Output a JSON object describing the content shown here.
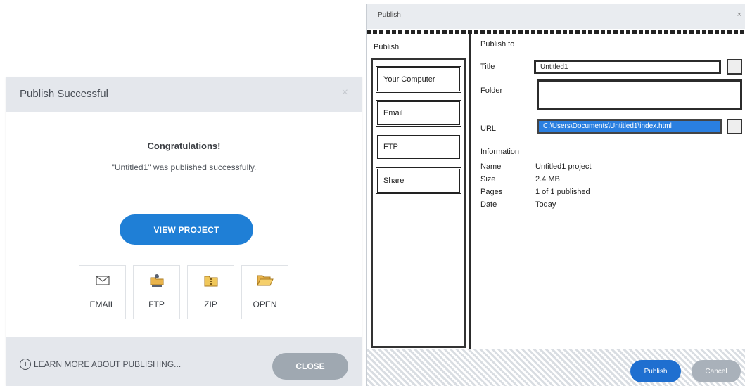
{
  "dialog": {
    "title": "Publish Successful",
    "close_icon": "×",
    "heading": "Congratulations!",
    "message": "\"Untitled1\" was published successfully.",
    "primary_button": "VIEW PROJECT",
    "options": [
      {
        "label": "EMAIL",
        "icon": "envelope-icon"
      },
      {
        "label": "FTP",
        "icon": "ftp-folder-icon"
      },
      {
        "label": "ZIP",
        "icon": "zip-folder-icon"
      },
      {
        "label": "OPEN",
        "icon": "open-folder-icon"
      }
    ],
    "learn_more": "LEARN MORE ABOUT PUBLISHING...",
    "close_button": "CLOSE"
  },
  "colors": {
    "accent": "#1f7fd6",
    "header_bg": "#e4e7ec",
    "close_button": "#9fa8b1"
  },
  "publish_window": {
    "title": "Publish",
    "close_icon": "×",
    "sidebar_heading": "Publish",
    "section_heading": "Publish to",
    "sidebar": [
      "Your Computer",
      "Email",
      "FTP",
      "Share"
    ],
    "fields": {
      "title_label": "Title",
      "title_value": "Untitled1",
      "folder_label": "Folder",
      "url_label": "URL",
      "url_value": "C:\\Users\\Documents\\Untitled1\\index.html"
    },
    "info_heading": "Information",
    "info": [
      {
        "key": "Name",
        "value": "Untitled1 project"
      },
      {
        "key": "Size",
        "value": "2.4 MB"
      },
      {
        "key": "Pages",
        "value": "1 of 1 published"
      },
      {
        "key": "Date",
        "value": "Today"
      }
    ],
    "publish_button": "Publish",
    "cancel_button": "Cancel"
  }
}
